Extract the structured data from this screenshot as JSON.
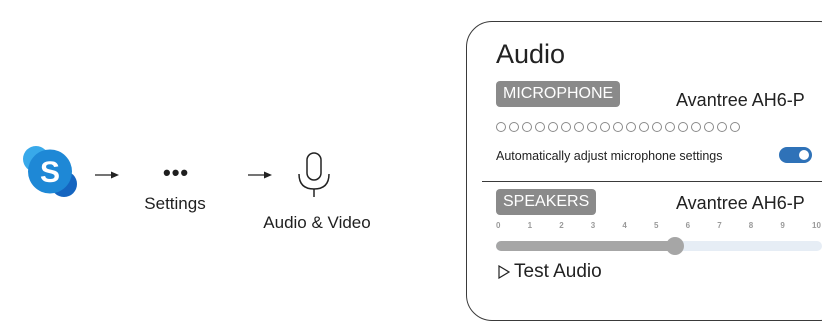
{
  "flow": {
    "settings_label": "Settings",
    "ellipsis_text": "•••",
    "audio_video_label": "Audio & Video",
    "icons": [
      "skype-icon",
      "arrow-right-icon",
      "more-icon",
      "microphone-icon"
    ]
  },
  "panel": {
    "title": "Audio",
    "microphone": {
      "section_label": "MICROPHONE",
      "device": "Avantree AH6-P",
      "level_dot_count": 19,
      "level_active": 0,
      "auto_adjust_label": "Automatically adjust microphone settings",
      "auto_adjust_enabled": true
    },
    "speakers": {
      "section_label": "SPEAKERS",
      "device": "Avantree AH6-P",
      "ticks": [
        "0",
        "1",
        "2",
        "3",
        "4",
        "5",
        "6",
        "7",
        "8",
        "9",
        "10"
      ],
      "volume": 5.6,
      "volume_max": 10
    },
    "test_audio_label": "Test Audio"
  },
  "colors": {
    "toggle_on": "#2f72b8",
    "skype_blue": "#1e88d6",
    "pill_gray": "#8a8a8a",
    "slider_gray": "#a6a6a6"
  }
}
